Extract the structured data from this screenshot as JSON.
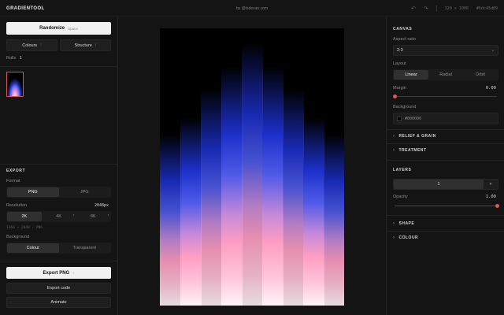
{
  "app": {
    "title": "GRADIENTOOL",
    "byline": "by @lodesan.com"
  },
  "topbar": {
    "undo_icon": "undo-icon",
    "redo_icon": "redo-icon",
    "size": "320 × 1000",
    "hash": "#6dc45d89"
  },
  "left": {
    "randomize_label": "Randomize",
    "randomize_hint": "Space",
    "colours_label": "Colours",
    "structure_label": "Structure",
    "rolls_label": "Rolls",
    "rolls_count": "1",
    "export": {
      "title": "EXPORT",
      "format_label": "Format",
      "formats": [
        "PNG",
        "JPG"
      ],
      "format_selected": 0,
      "resolution_label": "Resolution",
      "resolution_value": "2048px",
      "resolutions": [
        "2K",
        "4K",
        "8K"
      ],
      "resolution_selected": 0,
      "resolution_note": "1366 × 2048 · PNG",
      "background_label": "Background",
      "backgrounds": [
        "Colour",
        "Transparent"
      ],
      "background_selected": 0
    },
    "export_png_label": "Export PNG",
    "export_code_label": "Export code",
    "animate_label": "Animate"
  },
  "right": {
    "canvas": {
      "title": "CANVAS",
      "aspect_label": "Aspect ratio",
      "aspect_value": "2:3",
      "layout_label": "Layout",
      "layouts": [
        "Linear",
        "Radial",
        "Orbit"
      ],
      "layout_selected": 0,
      "margin_label": "Margin",
      "margin_value": "0.00",
      "margin_level": 0,
      "background_label": "Background",
      "background_value": "#000000",
      "background_color": "#000000"
    },
    "relief_label": "RELIEF & GRAIN",
    "treatment_label": "TREATMENT",
    "layers": {
      "title": "LAYERS",
      "current_layer": "1",
      "add_label": "+",
      "opacity_label": "Opacity",
      "opacity_value": "1.00",
      "opacity_level": 1
    },
    "shape_label": "SHAPE",
    "colour_label": "COLOUR"
  },
  "colors": {
    "accent": "#e2584a",
    "bg": "#141414",
    "panel_border": "#232323",
    "gradient_top": "#1c2fc9",
    "gradient_mid": "#ff9ec2",
    "gradient_bottom": "#fff4f8"
  }
}
